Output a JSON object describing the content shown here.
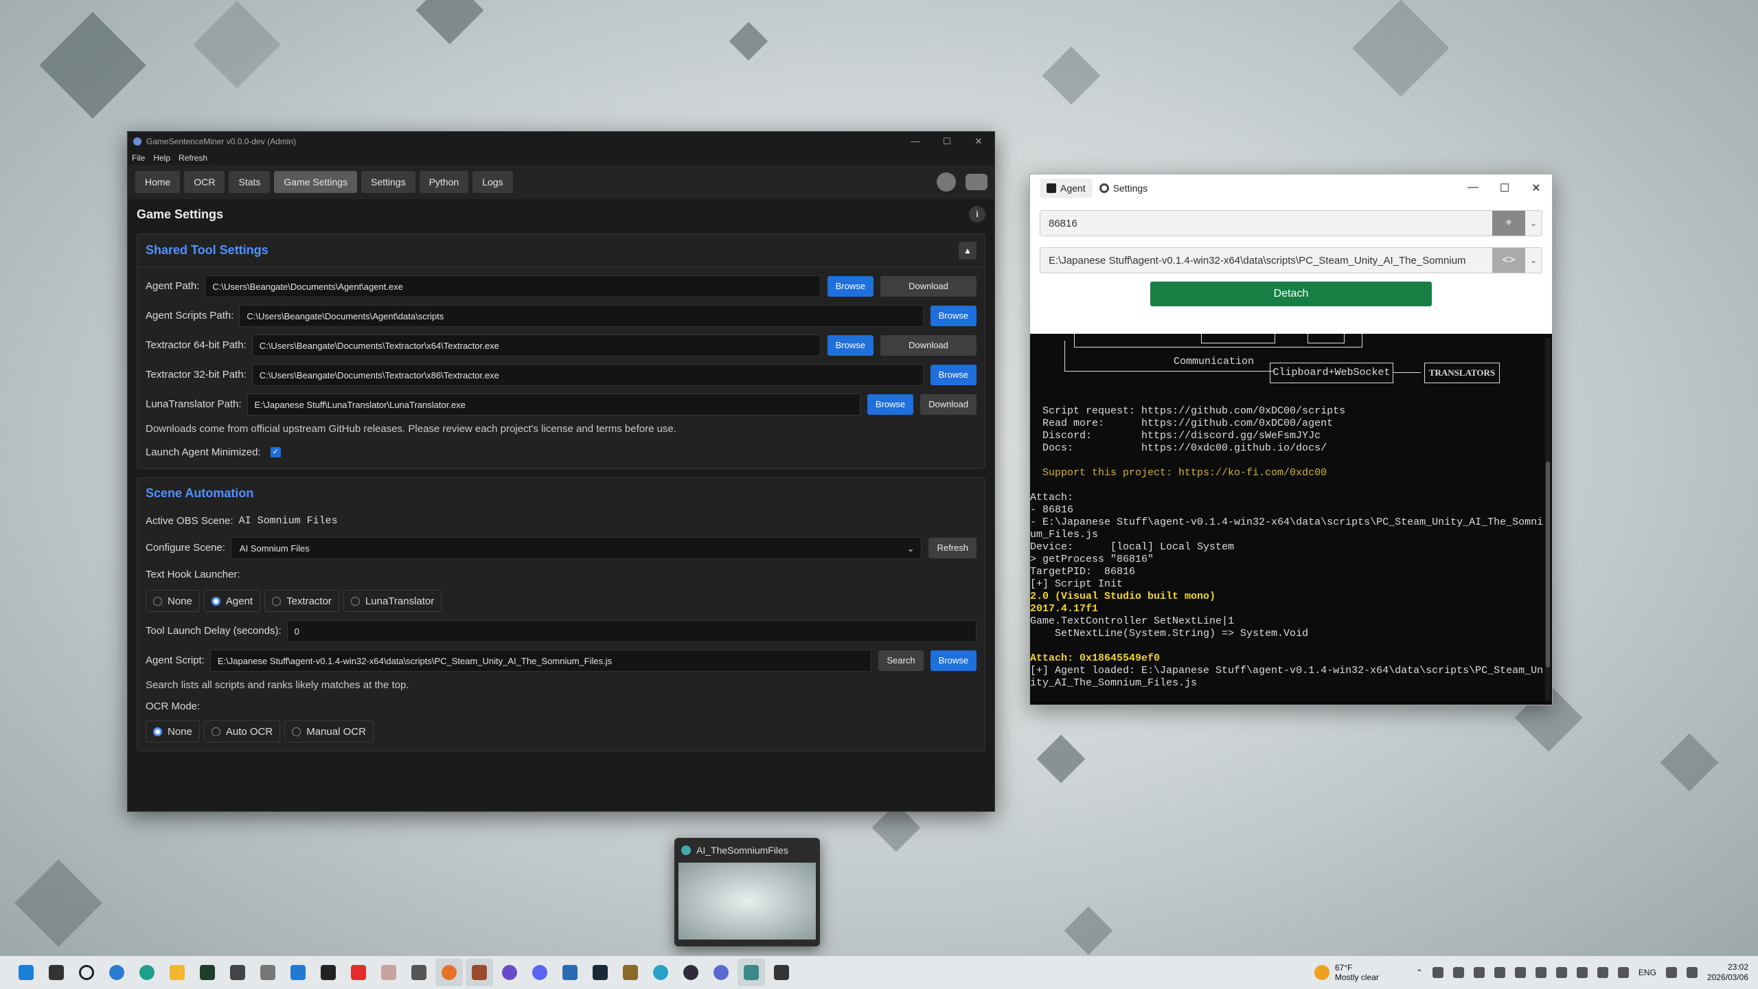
{
  "gsm": {
    "title": "GameSentenceMiner v0.0.0-dev (Admin)",
    "menu": [
      "File",
      "Help",
      "Refresh"
    ],
    "tabs": [
      "Home",
      "OCR",
      "Stats",
      "Game Settings",
      "Settings",
      "Python",
      "Logs"
    ],
    "active_tab": "Game Settings",
    "page_title": "Game Settings",
    "info_label": "i",
    "shared": {
      "title": "Shared Tool Settings",
      "agent_path_label": "Agent Path:",
      "agent_path": "C:\\Users\\Beangate\\Documents\\Agent\\agent.exe",
      "agent_scripts_label": "Agent Scripts Path:",
      "agent_scripts": "C:\\Users\\Beangate\\Documents\\Agent\\data\\scripts",
      "tx64_label": "Textractor 64-bit Path:",
      "tx64": "C:\\Users\\Beangate\\Documents\\Textractor\\x64\\Textractor.exe",
      "tx32_label": "Textractor 32-bit Path:",
      "tx32": "C:\\Users\\Beangate\\Documents\\Textractor\\x86\\Textractor.exe",
      "luna_label": "LunaTranslator Path:",
      "luna": "E:\\Japanese Stuff\\LunaTranslator\\LunaTranslator.exe",
      "browse": "Browse",
      "download": "Download",
      "note": "Downloads come from official upstream GitHub releases. Please review each project's license and terms before use.",
      "launch_min_label": "Launch Agent Minimized:",
      "checkmark": "✓"
    },
    "scene": {
      "title": "Scene Automation",
      "active_obs_label": "Active OBS Scene:",
      "active_obs": "AI Somnium Files",
      "configure_label": "Configure Scene:",
      "configure_value": "AI Somnium Files",
      "refresh": "Refresh",
      "hook_label": "Text Hook Launcher:",
      "hook_options": [
        "None",
        "Agent",
        "Textractor",
        "LunaTranslator"
      ],
      "delay_label": "Tool Launch Delay (seconds):",
      "delay_value": "0",
      "script_label": "Agent Script:",
      "script_value": "E:\\Japanese Stuff\\agent-v0.1.4-win32-x64\\data\\scripts\\PC_Steam_Unity_AI_The_Somnium_Files.js",
      "search": "Search",
      "browse": "Browse",
      "search_note": "Search lists all scripts and ranks likely matches at the top.",
      "ocr_label": "OCR Mode:",
      "ocr_options": [
        "None",
        "Auto OCR",
        "Manual OCR"
      ]
    }
  },
  "agent": {
    "tab_agent": "Agent",
    "tab_settings": "Settings",
    "pid": "86816",
    "script_path": "E:\\Japanese Stuff\\agent-v0.1.4-win32-x64\\data\\scripts\\PC_Steam_Unity_AI_The_Somnium",
    "detach": "Detach",
    "diagram": {
      "communication": "Communication",
      "clipboard": "Clipboard+WebSocket",
      "translators": "TRANSLATORS"
    },
    "log_info": "Script request: https://github.com/0xDC00/scripts\nRead more:      https://github.com/0xDC00/agent\nDiscord:        https://discord.gg/sWeFsmJYJc\nDocs:           https://0xdc00.github.io/docs/",
    "log_support": "Support this project: https://ko-fi.com/0xdc00",
    "log_attach": "Attach:\n- 86816\n- E:\\Japanese Stuff\\agent-v0.1.4-win32-x64\\data\\scripts\\PC_Steam_Unity_AI_The_Somni\num_Files.js\nDevice:      [local] Local System\n> getProcess \"86816\"\nTargetPID:  86816\n[+] Script Init",
    "log_mono": "2.0 (Visual Studio built mono)\n2017.4.17f1",
    "log_hook": "Game.TextController SetNextLine|1\n    SetNextLine(System.String) => System.Void",
    "log_attach_addr": "Attach: 0x18645549ef0",
    "log_loaded": "[+] Agent loaded: E:\\Japanese Stuff\\agent-v0.1.4-win32-x64\\data\\scripts\\PC_Steam_Un\nity_AI_The_Somnium_Files.js"
  },
  "thumbnail": {
    "title": "AI_TheSomniumFiles"
  },
  "taskbar": {
    "weather_temp": "67°F",
    "weather_desc": "Mostly clear",
    "lang": "ENG",
    "time": "23:02",
    "date": "2026/03/06"
  },
  "colors": {
    "accent": "#1f6fdc",
    "section_title": "#4f93ff",
    "detach": "#177f43"
  }
}
